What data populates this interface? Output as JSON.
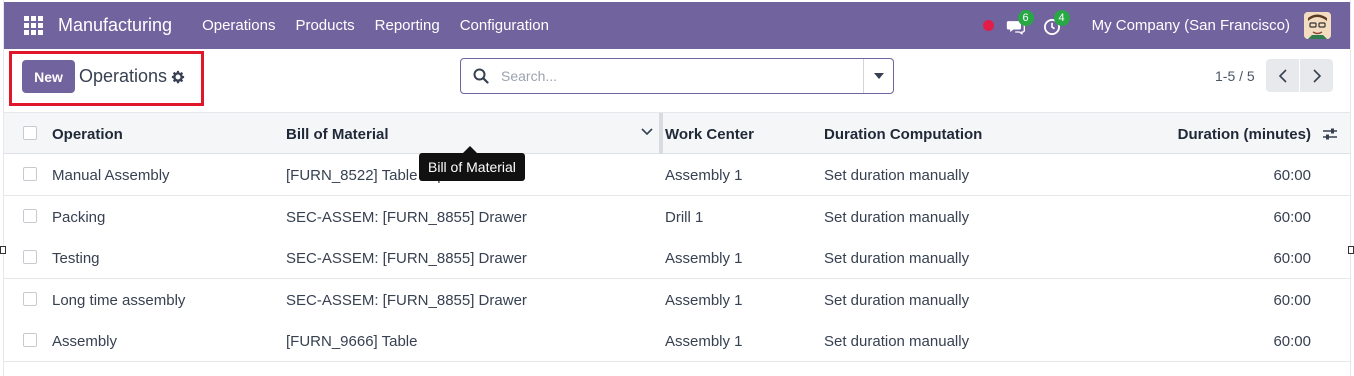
{
  "navbar": {
    "brand": "Manufacturing",
    "menu": [
      "Operations",
      "Products",
      "Reporting",
      "Configuration"
    ],
    "messages_count": "6",
    "activities_count": "4",
    "company": "My Company (San Francisco)"
  },
  "control_panel": {
    "new_label": "New",
    "breadcrumb": "Operations",
    "search_placeholder": "Search...",
    "pager": "1-5 / 5"
  },
  "table": {
    "headers": {
      "operation": "Operation",
      "bom": "Bill of Material",
      "work_center": "Work Center",
      "duration_computation": "Duration Computation",
      "duration": "Duration (minutes)"
    },
    "rows": [
      {
        "operation": "Manual Assembly",
        "bom": "[FURN_8522] Table Top",
        "work_center": "Assembly 1",
        "computation": "Set duration manually",
        "duration": "60:00"
      },
      {
        "operation": "Packing",
        "bom": "SEC-ASSEM: [FURN_8855] Drawer",
        "work_center": "Drill 1",
        "computation": "Set duration manually",
        "duration": "60:00"
      },
      {
        "operation": "Testing",
        "bom": "SEC-ASSEM: [FURN_8855] Drawer",
        "work_center": "Assembly 1",
        "computation": "Set duration manually",
        "duration": "60:00"
      },
      {
        "operation": "Long time assembly",
        "bom": "SEC-ASSEM: [FURN_8855] Drawer",
        "work_center": "Assembly 1",
        "computation": "Set duration manually",
        "duration": "60:00"
      },
      {
        "operation": "Assembly",
        "bom": "[FURN_9666] Table",
        "work_center": "Assembly 1",
        "computation": "Set duration manually",
        "duration": "60:00"
      }
    ]
  },
  "tooltip": "Bill of Material",
  "colors": {
    "brand": "#71639e",
    "highlight_border": "#e0162b",
    "badge": "#28a745",
    "record_dot": "#e11d48"
  },
  "icons": [
    "apps-grid-icon",
    "record-dot-icon",
    "messages-icon",
    "activity-clock-icon",
    "avatar",
    "gear-icon",
    "search-icon",
    "caret-down-icon",
    "chevron-left-icon",
    "chevron-right-icon",
    "sort-chevron-icon",
    "optional-columns-icon"
  ]
}
